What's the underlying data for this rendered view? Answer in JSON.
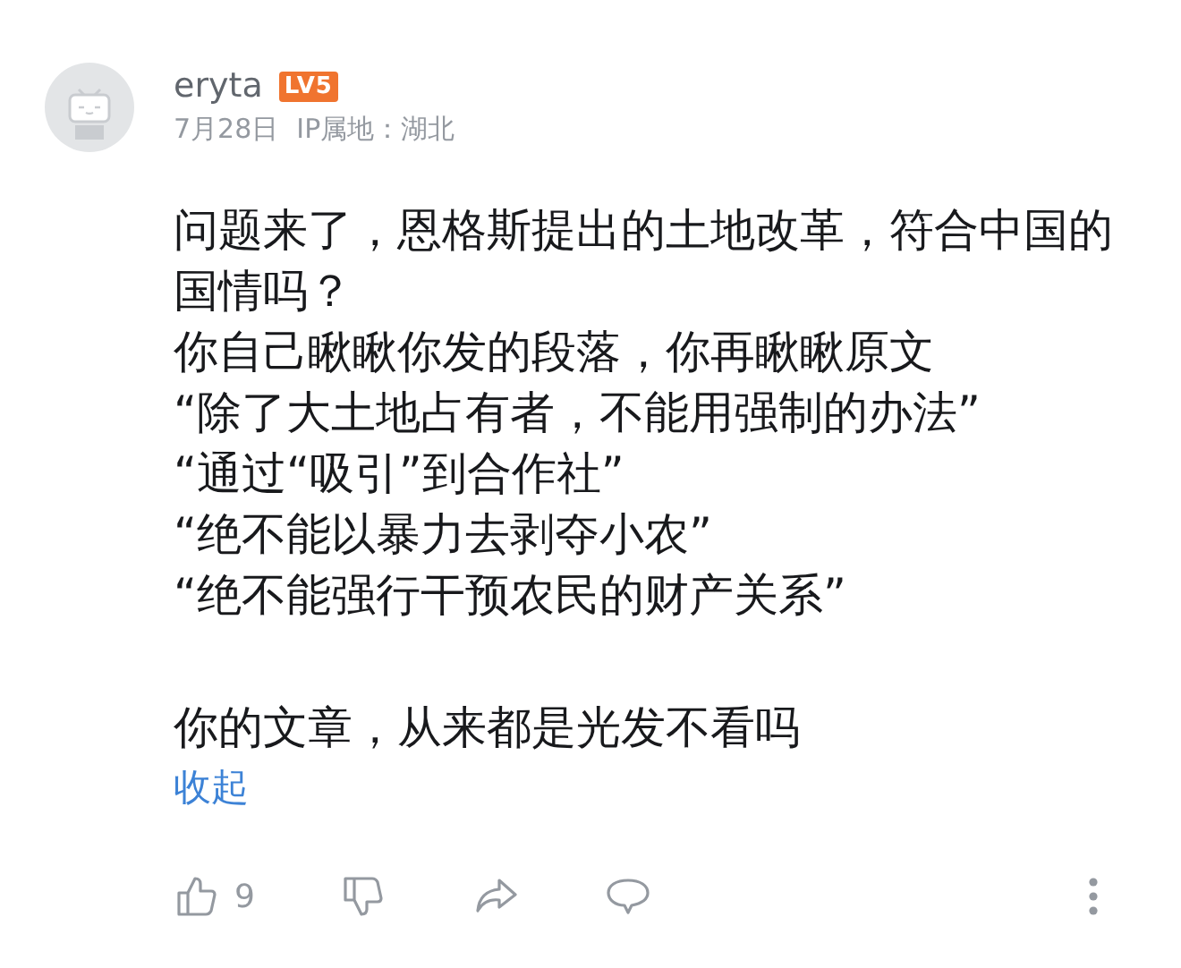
{
  "comment": {
    "username": "eryta",
    "level_badge": "LV5",
    "date": "7月28日",
    "ip_location": "IP属地：湖北",
    "paragraphs": [
      "问题来了，恩格斯提出的土地改革，符合中国的国情吗？",
      "你自己瞅瞅你发的段落，你再瞅瞅原文",
      "“除了大土地占有者，不能用强制的办法”",
      "“通过“吸引”到合作社”",
      "“绝不能以暴力去剥夺小农”",
      "“绝不能强行干预农民的财产关系”"
    ],
    "closing": "你的文章，从来都是光发不看吗",
    "collapse_link": "收起",
    "like_count": "9"
  }
}
